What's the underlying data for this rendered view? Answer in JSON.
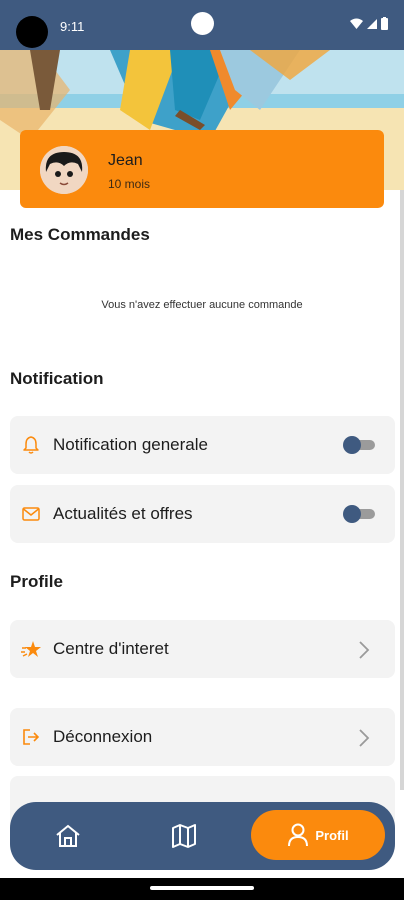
{
  "status_bar": {
    "time": "9:11"
  },
  "profile": {
    "name": "Jean",
    "age": "10 mois"
  },
  "orders": {
    "title": "Mes Commandes",
    "empty_message": "Vous n'avez effectuer aucune commande"
  },
  "notification": {
    "title": "Notification",
    "items": [
      {
        "label": "Notification generale",
        "icon": "bell-icon",
        "enabled": false
      },
      {
        "label": "Actualités et offres",
        "icon": "mail-icon",
        "enabled": false
      }
    ]
  },
  "profile_section": {
    "title": "Profile",
    "items": [
      {
        "label": "Centre d'interet",
        "icon": "star-icon"
      },
      {
        "label": "Déconnexion",
        "icon": "logout-icon"
      }
    ]
  },
  "bottom_nav": {
    "items": [
      {
        "name": "home",
        "icon": "home-icon"
      },
      {
        "name": "map",
        "icon": "map-icon"
      },
      {
        "name": "profile",
        "icon": "user-icon",
        "label": "Profil",
        "active": true
      }
    ]
  },
  "colors": {
    "primary_navy": "#3f5a80",
    "accent_orange": "#fb8a0d",
    "row_background": "#f3f3f3"
  }
}
